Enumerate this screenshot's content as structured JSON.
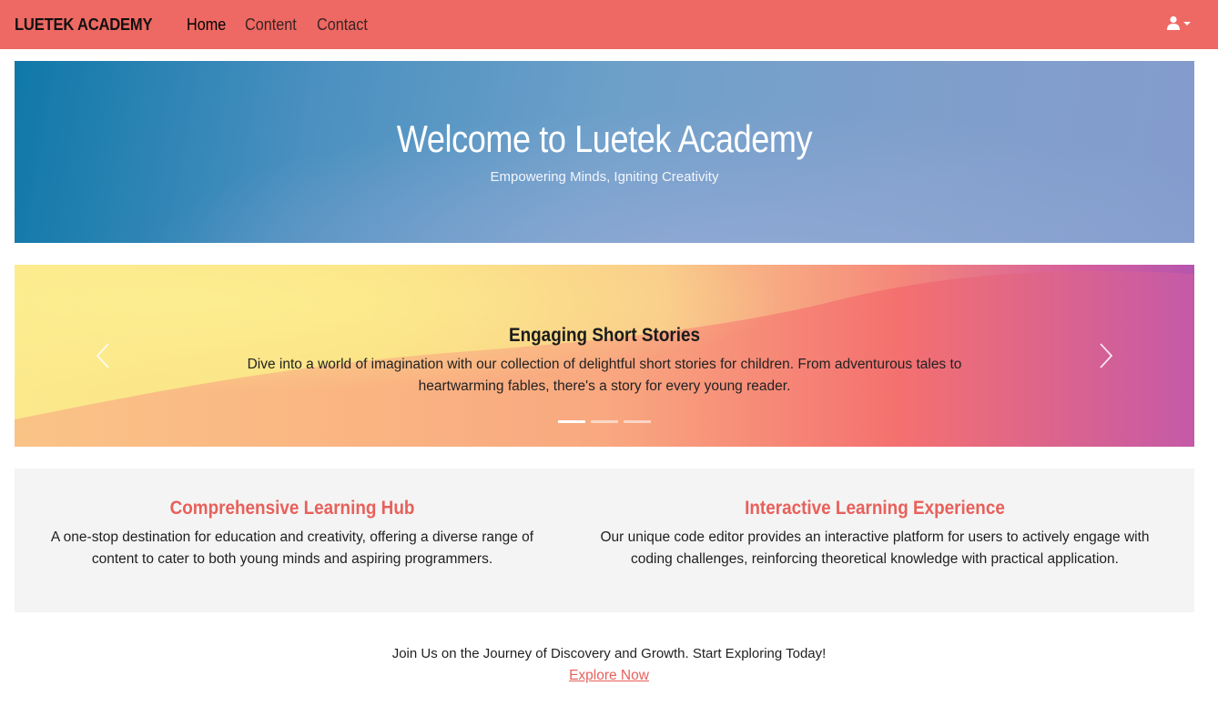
{
  "navbar": {
    "brand": "LUETEK ACADEMY",
    "links": [
      "Home",
      "Content",
      "Contact"
    ],
    "active": "Home",
    "user_icon": "user-icon",
    "caret_icon": "caret-down-icon",
    "bg_color": "#ee6963"
  },
  "hero": {
    "title": "Welcome to Luetek Academy",
    "subtitle": "Empowering Minds, Igniting Creativity"
  },
  "carousel": {
    "slide_title": "Engaging Short Stories",
    "slide_text": "Dive into a world of imagination with our collection of delightful short stories for children. From adventurous tales to heartwarming fables, there's a story for every young reader.",
    "prev_icon": "chevron-left-icon",
    "next_icon": "chevron-right-icon",
    "slide_count": 3,
    "active_index": 0
  },
  "features": [
    {
      "title": "Comprehensive Learning Hub",
      "text": "A one-stop destination for education and creativity, offering a diverse range of content to cater to both young minds and aspiring programmers."
    },
    {
      "title": "Interactive Learning Experience",
      "text": "Our unique code editor provides an interactive platform for users to actively engage with coding challenges, reinforcing theoretical knowledge with practical application."
    }
  ],
  "cta": {
    "text": "Join Us on the Journey of Discovery and Growth. Start Exploring Today!",
    "link": "Explore Now"
  },
  "colors": {
    "accent": "#e8605b",
    "feature_bg": "#f4f4f4"
  }
}
